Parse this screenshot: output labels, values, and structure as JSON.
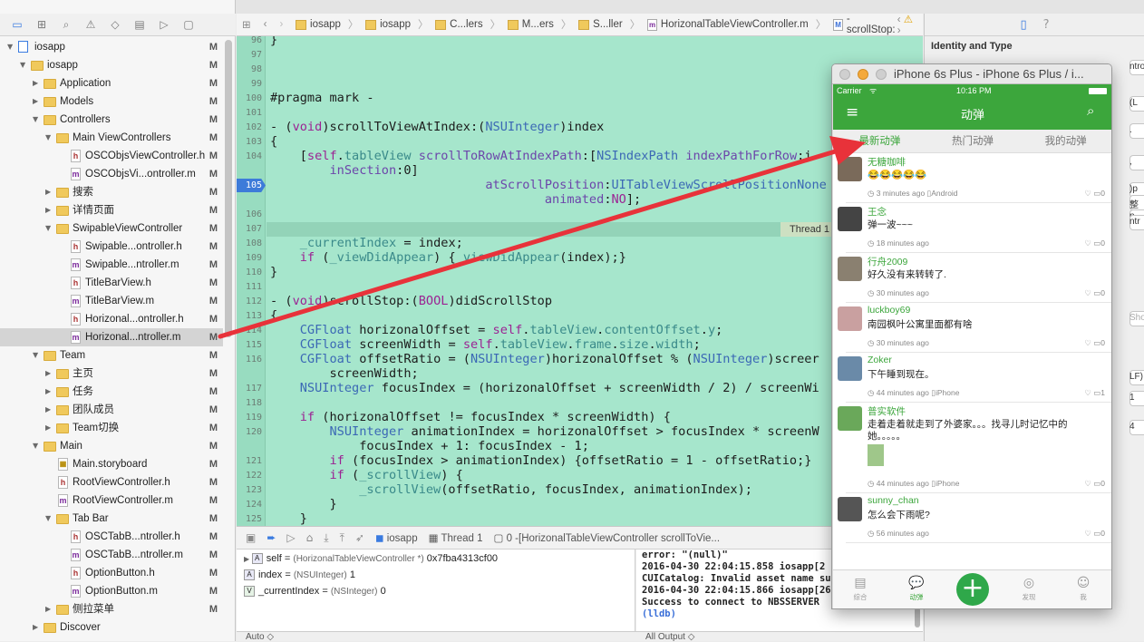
{
  "navigator": {
    "tree": [
      {
        "label": "iosapp",
        "kind": "proj",
        "depth": 0,
        "open": true,
        "status": "M"
      },
      {
        "label": "iosapp",
        "kind": "folder",
        "depth": 1,
        "open": true,
        "status": "M"
      },
      {
        "label": "Application",
        "kind": "folder",
        "depth": 2,
        "open": false,
        "status": "M"
      },
      {
        "label": "Models",
        "kind": "folder",
        "depth": 2,
        "open": false,
        "status": "M"
      },
      {
        "label": "Controllers",
        "kind": "folder",
        "depth": 2,
        "open": true,
        "status": "M"
      },
      {
        "label": "Main ViewControllers",
        "kind": "folder",
        "depth": 3,
        "open": true,
        "status": "M"
      },
      {
        "label": "OSCObjsViewController.h",
        "kind": "h",
        "depth": 4,
        "status": "M"
      },
      {
        "label": "OSCObjsVi...ontroller.m",
        "kind": "m",
        "depth": 4,
        "status": "M"
      },
      {
        "label": "搜索",
        "kind": "folder",
        "depth": 3,
        "open": false,
        "status": "M"
      },
      {
        "label": "详情页面",
        "kind": "folder",
        "depth": 3,
        "open": false,
        "status": "M"
      },
      {
        "label": "SwipableViewController",
        "kind": "folder",
        "depth": 3,
        "open": true,
        "status": "M"
      },
      {
        "label": "Swipable...ontroller.h",
        "kind": "h",
        "depth": 4,
        "status": "M"
      },
      {
        "label": "Swipable...ntroller.m",
        "kind": "m",
        "depth": 4,
        "status": "M"
      },
      {
        "label": "TitleBarView.h",
        "kind": "h",
        "depth": 4,
        "status": "M"
      },
      {
        "label": "TitleBarView.m",
        "kind": "m",
        "depth": 4,
        "status": "M"
      },
      {
        "label": "Horizonal...ontroller.h",
        "kind": "h",
        "depth": 4,
        "status": "M"
      },
      {
        "label": "Horizonal...ntroller.m",
        "kind": "m",
        "depth": 4,
        "status": "M",
        "selected": true
      },
      {
        "label": "Team",
        "kind": "folder",
        "depth": 2,
        "open": true,
        "status": "M"
      },
      {
        "label": "主页",
        "kind": "folder",
        "depth": 3,
        "open": false,
        "status": "M"
      },
      {
        "label": "任务",
        "kind": "folder",
        "depth": 3,
        "open": false,
        "status": "M"
      },
      {
        "label": "团队成员",
        "kind": "folder",
        "depth": 3,
        "open": false,
        "status": "M"
      },
      {
        "label": "Team切换",
        "kind": "folder",
        "depth": 3,
        "open": false,
        "status": "M"
      },
      {
        "label": "Main",
        "kind": "folder",
        "depth": 2,
        "open": true,
        "status": "M"
      },
      {
        "label": "Main.storyboard",
        "kind": "sb",
        "depth": 3,
        "status": "M"
      },
      {
        "label": "RootViewController.h",
        "kind": "h",
        "depth": 3,
        "status": "M"
      },
      {
        "label": "RootViewController.m",
        "kind": "m",
        "depth": 3,
        "status": "M"
      },
      {
        "label": "Tab Bar",
        "kind": "folder",
        "depth": 3,
        "open": true,
        "status": "M"
      },
      {
        "label": "OSCTabB...ntroller.h",
        "kind": "h",
        "depth": 4,
        "status": "M"
      },
      {
        "label": "OSCTabB...ntroller.m",
        "kind": "m",
        "depth": 4,
        "status": "M"
      },
      {
        "label": "OptionButton.h",
        "kind": "h",
        "depth": 4,
        "status": "M"
      },
      {
        "label": "OptionButton.m",
        "kind": "m",
        "depth": 4,
        "status": "M"
      },
      {
        "label": "侧拉菜单",
        "kind": "folder",
        "depth": 3,
        "open": false,
        "status": "M"
      },
      {
        "label": "Discover",
        "kind": "folder",
        "depth": 2,
        "open": false,
        "status": ""
      }
    ]
  },
  "jumpbar": {
    "crumbs": [
      "iosapp",
      "iosapp",
      "C...lers",
      "M...ers",
      "S...ller",
      "HorizonalTableViewController.m",
      "-scrollStop:"
    ],
    "method_badge": "M"
  },
  "editor": {
    "lines": [
      {
        "n": "96",
        "html": "}"
      },
      {
        "n": "97",
        "html": ""
      },
      {
        "n": "98",
        "html": ""
      },
      {
        "n": "99",
        "html": ""
      },
      {
        "n": "100",
        "html": "#pragma mark -"
      },
      {
        "n": "101",
        "html": ""
      },
      {
        "n": "102",
        "html": "- (<span class=\"kw\">void</span>)scrollToViewAtIndex:(<span class=\"ty\">NSUInteger</span>)index"
      },
      {
        "n": "103",
        "html": "{"
      },
      {
        "n": "104",
        "html": "    [<span class=\"kw\">self</span>.<span class=\"pr\">tableView</span> <span class=\"ds\">scrollToRowAtIndexPath</span>:[<span class=\"ty\">NSIndexPath</span> <span class=\"ds\">indexPathForRow</span>:i"
      },
      {
        "n": "",
        "html": "        <span class=\"ds\">inSection</span>:0]"
      },
      {
        "n": "105",
        "html": "                             <span class=\"ds\">atScrollPosition</span>:<span class=\"ty\">UITableViewScrollPositionNone</span>"
      },
      {
        "n": "",
        "html": "                                     <span class=\"ds\">animated</span>:<span class=\"kw\">NO</span>];"
      },
      {
        "n": "106",
        "html": ""
      },
      {
        "n": "107",
        "html": ""
      },
      {
        "n": "108",
        "html": "    <span class=\"pr\">_currentIndex</span> = index;"
      },
      {
        "n": "109",
        "html": "    <span class=\"kw\">if</span> (<span class=\"pr\">_viewDidAppear</span>) {<span class=\"pr\">_viewDidAppear</span>(index);}"
      },
      {
        "n": "110",
        "html": "}"
      },
      {
        "n": "111",
        "html": ""
      },
      {
        "n": "112",
        "html": "- (<span class=\"kw\">void</span>)scrollStop:(<span class=\"kw\">BOOL</span>)didScrollStop"
      },
      {
        "n": "113",
        "html": "{"
      },
      {
        "n": "114",
        "html": "    <span class=\"ty\">CGFloat</span> horizonalOffset = <span class=\"kw\">self</span>.<span class=\"pr\">tableView</span>.<span class=\"pr\">contentOffset</span>.<span class=\"pr\">y</span>;"
      },
      {
        "n": "115",
        "html": "    <span class=\"ty\">CGFloat</span> screenWidth = <span class=\"kw\">self</span>.<span class=\"pr\">tableView</span>.<span class=\"pr\">frame</span>.<span class=\"pr\">size</span>.<span class=\"pr\">width</span>;"
      },
      {
        "n": "116",
        "html": "    <span class=\"ty\">CGFloat</span> offsetRatio = (<span class=\"ty\">NSUInteger</span>)horizonalOffset % (<span class=\"ty\">NSUInteger</span>)screer"
      },
      {
        "n": "",
        "html": "        screenWidth;"
      },
      {
        "n": "117",
        "html": "    <span class=\"ty\">NSUInteger</span> focusIndex = (horizonalOffset + screenWidth / 2) / screenWi"
      },
      {
        "n": "118",
        "html": ""
      },
      {
        "n": "119",
        "html": "    <span class=\"kw\">if</span> (horizonalOffset != focusIndex * screenWidth) {"
      },
      {
        "n": "120",
        "html": "        <span class=\"ty\">NSUInteger</span> animationIndex = horizonalOffset > focusIndex * screenW"
      },
      {
        "n": "",
        "html": "            focusIndex + 1: focusIndex - 1;"
      },
      {
        "n": "121",
        "html": "        <span class=\"kw\">if</span> (focusIndex > animationIndex) {offsetRatio = 1 - offsetRatio;}"
      },
      {
        "n": "122",
        "html": "        <span class=\"kw\">if</span> (<span class=\"pr\">_scrollView</span>) {"
      },
      {
        "n": "123",
        "html": "            <span class=\"pr\">_scrollView</span>(offsetRatio, focusIndex, animationIndex);"
      },
      {
        "n": "124",
        "html": "        }"
      },
      {
        "n": "125",
        "html": "    }"
      },
      {
        "n": "126",
        "html": ""
      }
    ],
    "thread_label": "Thread 1"
  },
  "debugbar": {
    "target": "iosapp",
    "thread": "Thread 1",
    "frame": "0 -[HorizonalTableViewController scrollToVie..."
  },
  "variables": [
    {
      "badge": "A",
      "name": "self",
      "type": "(HorizonalTableViewController *)",
      "value": "0x7fba4313cf00",
      "expand": true
    },
    {
      "badge": "A",
      "name": "index",
      "type": "(NSUInteger)",
      "value": "1",
      "expand": false
    },
    {
      "badge": "V",
      "name": "_currentIndex",
      "type": "(NSInteger)",
      "value": "0",
      "expand": false
    }
  ],
  "bottom": {
    "auto": "Auto ◇",
    "all_output": "All Output ◇"
  },
  "console": {
    "lines": [
      "error: \"(null)\"",
      "2016-04-30 22:04:15.858 iosapp[2",
      "CUICatalog: Invalid asset name supplied:",
      "2016-04-30 22:04:15.866 iosapp[2686:29940]",
      "Success to connect to NBSSERVER"
    ],
    "prompt": "(lldb)"
  },
  "inspector": {
    "title": "Identity and Type",
    "side_texts": [
      "ntroll",
      "(L",
      ".",
      ",",
      ")p",
      "整",
      "p",
      "ntr",
      "Show",
      "LF)",
      "1",
      "4"
    ]
  },
  "simulator": {
    "title": "iPhone 6s Plus - iPhone 6s Plus / i...",
    "carrier": "Carrier",
    "time": "10:16 PM",
    "nav_title": "动弹",
    "tabs": [
      "最新动弹",
      "热门动弹",
      "我的动弹"
    ],
    "feed": [
      {
        "user": "无糖咖啡",
        "msg": "😂😂😂😂😂",
        "time": "3 minutes ago",
        "source": "Android",
        "likes": "0",
        "avatar_color": "#7a6a5a"
      },
      {
        "user": "王念",
        "msg": "弹一波~~~",
        "time": "18 minutes ago",
        "source": "",
        "likes": "0",
        "avatar_color": "#444"
      },
      {
        "user": "行舟2009",
        "msg": "好久没有来转转了.",
        "time": "30 minutes ago",
        "source": "",
        "likes": "0",
        "avatar_color": "#8a8070"
      },
      {
        "user": "luckboy69",
        "msg": "南园枫叶公寓里面都有啥",
        "time": "30 minutes ago",
        "source": "",
        "likes": "0",
        "avatar_color": "#c9a0a0"
      },
      {
        "user": "Zoker",
        "msg": "下午睡到现在。",
        "time": "44 minutes ago",
        "source": "iPhone",
        "likes": "1",
        "avatar_color": "#6a8aa8"
      },
      {
        "user": "普实软件",
        "msg": "走着走着就走到了外婆家。。。找寻儿时记忆中的她。。。。。",
        "time": "44 minutes ago",
        "source": "iPhone",
        "likes": "0",
        "avatar_color": "#6aa85a"
      },
      {
        "user": "sunny_chan",
        "msg": "怎么会下雨呢?",
        "time": "56 minutes ago",
        "source": "",
        "likes": "0",
        "avatar_color": "#555"
      }
    ],
    "tabbar": [
      "综合",
      "动弹",
      "",
      "发现",
      "我"
    ],
    "accent": "#3ca63c"
  }
}
